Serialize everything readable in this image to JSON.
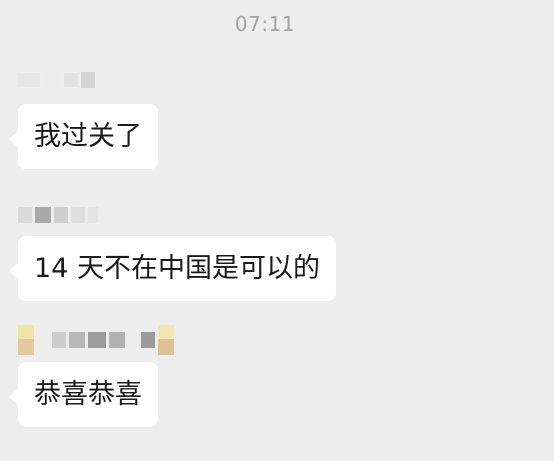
{
  "status": {
    "time": "07:11"
  },
  "messages": [
    {
      "text": "我过关了"
    },
    {
      "text": "14 天不在中国是可以的"
    },
    {
      "text": "恭喜恭喜"
    }
  ]
}
